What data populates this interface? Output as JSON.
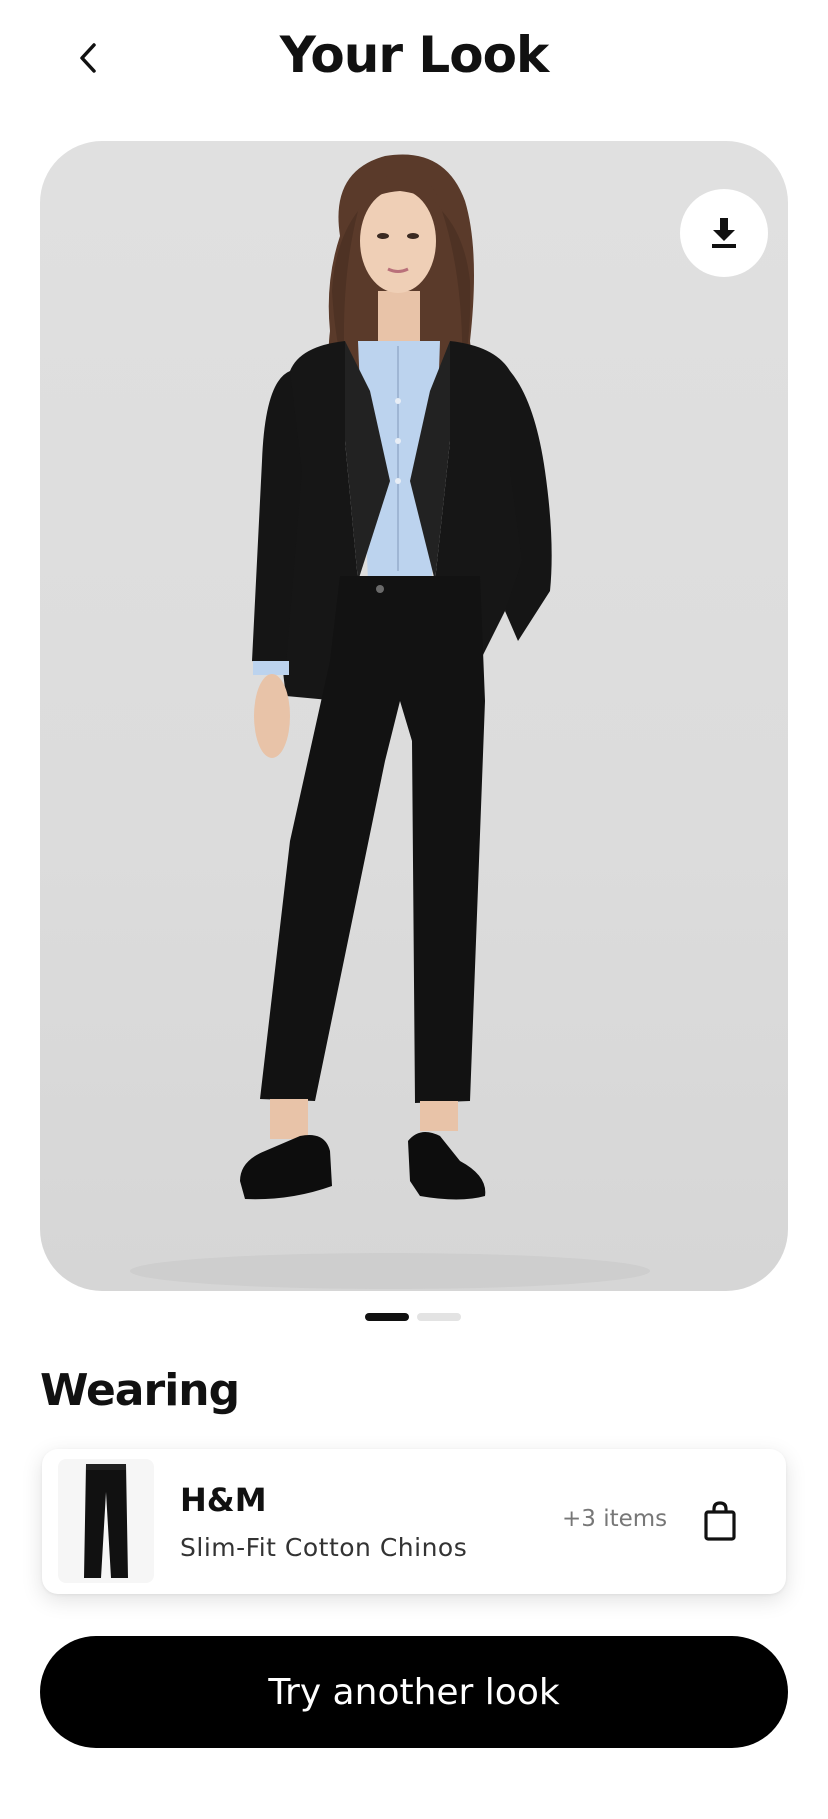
{
  "header": {
    "title": "Your Look",
    "back_icon": "chevron-left-icon"
  },
  "photo": {
    "download_icon": "download-icon",
    "pager": {
      "count": 2,
      "active": 0
    }
  },
  "wearing": {
    "title": "Wearing",
    "item": {
      "brand": "H&M",
      "name": "Slim-Fit Cotton Chinos",
      "extra": "+3 items",
      "thumb_icon": "pants-thumbnail",
      "bag_icon": "shopping-bag-icon"
    }
  },
  "cta": {
    "label": "Try another look"
  },
  "colors": {
    "background": "#ffffff",
    "cta_bg": "#000000",
    "cta_text": "#ffffff",
    "photo_bg": "#dcdcdc"
  }
}
